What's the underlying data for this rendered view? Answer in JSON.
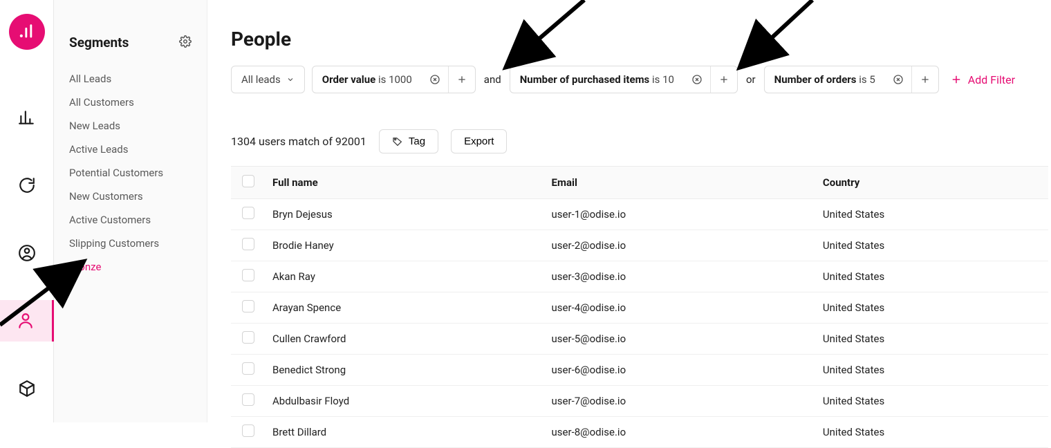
{
  "sidebar": {
    "title": "Segments",
    "items": [
      {
        "label": "All Leads",
        "active": false
      },
      {
        "label": "All Customers",
        "active": false
      },
      {
        "label": "New Leads",
        "active": false
      },
      {
        "label": "Active Leads",
        "active": false
      },
      {
        "label": "Potential Customers",
        "active": false
      },
      {
        "label": "New Customers",
        "active": false
      },
      {
        "label": "Active Customers",
        "active": false
      },
      {
        "label": "Slipping Customers",
        "active": false
      },
      {
        "label": "Bronze",
        "active": true
      }
    ]
  },
  "page": {
    "title": "People",
    "leads_dropdown": "All leads"
  },
  "filters": [
    {
      "field": "Order value",
      "relation": "is",
      "value": "1000",
      "join_after": "and"
    },
    {
      "field": "Number of purchased items",
      "relation": "is",
      "value": "10",
      "join_after": "or"
    },
    {
      "field": "Number of orders",
      "relation": "is",
      "value": "5",
      "join_after": null
    }
  ],
  "add_filter_label": "Add Filter",
  "match_summary": "1304 users match of 92001",
  "actions": {
    "tag": "Tag",
    "export": "Export"
  },
  "table": {
    "columns": [
      "Full name",
      "Email",
      "Country"
    ],
    "rows": [
      {
        "name": "Bryn Dejesus",
        "email": "user-1@odise.io",
        "country": "United States"
      },
      {
        "name": "Brodie Haney",
        "email": "user-2@odise.io",
        "country": "United States"
      },
      {
        "name": "Akan Ray",
        "email": "user-3@odise.io",
        "country": "United States"
      },
      {
        "name": "Arayan Spence",
        "email": "user-4@odise.io",
        "country": "United States"
      },
      {
        "name": "Cullen Crawford",
        "email": "user-5@odise.io",
        "country": "United States"
      },
      {
        "name": "Benedict Strong",
        "email": "user-6@odise.io",
        "country": "United States"
      },
      {
        "name": "Abdulbasir Floyd",
        "email": "user-7@odise.io",
        "country": "United States"
      },
      {
        "name": "Brett Dillard",
        "email": "user-8@odise.io",
        "country": "United States"
      }
    ]
  }
}
